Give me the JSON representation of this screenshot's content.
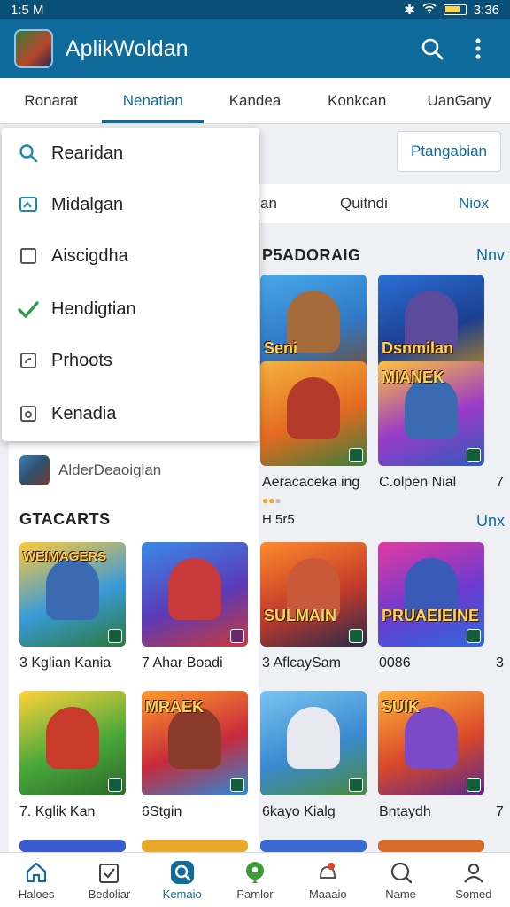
{
  "status": {
    "time": "1:5 M",
    "battery_text": "3:36"
  },
  "app": {
    "title": "AplikWoldan"
  },
  "tabs": [
    "Ronarat",
    "Nenatian",
    "Kandea",
    "Konkcan",
    "UanGany"
  ],
  "active_tab": 1,
  "filter_button": "Ptangabian",
  "chipbar": {
    "left": "an",
    "middle": "Quitndi",
    "right": "Niox"
  },
  "section1": {
    "title": "P5ADORAIG",
    "more": "Nnv"
  },
  "section2": {
    "more": "Unx"
  },
  "dropdown": [
    {
      "label": "Rearidan",
      "icon": "search-icon"
    },
    {
      "label": "Midalgan",
      "icon": "gallery-icon"
    },
    {
      "label": "Aiscigdha",
      "icon": "checkbox-empty-icon"
    },
    {
      "label": "Hendigtian",
      "icon": "check-icon"
    },
    {
      "label": "Prhoots",
      "icon": "photo-icon"
    },
    {
      "label": "Kenadia",
      "icon": "image-icon"
    }
  ],
  "left_panel": {
    "heading": "AlderDeaoiglan",
    "section": "GTACARTS"
  },
  "right_cards": [
    {
      "title": "Seni",
      "caption": ""
    },
    {
      "title": "Dsnmilan",
      "caption": ""
    },
    {
      "title": "",
      "caption": "Aeracaceka ing"
    },
    {
      "title": "MIANEK",
      "caption": "C.olpen Nial"
    },
    {
      "title": "SULMAIN",
      "caption": "3 AflcaySam"
    },
    {
      "title": "PRUAEIEINE",
      "caption": "0086"
    },
    {
      "title": "",
      "caption": "6kayo Kialg"
    },
    {
      "title": "SUIK",
      "caption": "Bntaydh"
    }
  ],
  "rating_text": "H 5r5",
  "left_cards": [
    {
      "title": "WEIMAGERS",
      "caption": "3 Kglian Kania"
    },
    {
      "title": "",
      "caption": "7 Ahar Boadi"
    },
    {
      "title": "",
      "caption": "7. Kglik Kan"
    },
    {
      "title": "MRAEK",
      "caption": "6Stgin"
    }
  ],
  "bottom_nav": [
    {
      "label": "Haloes",
      "icon": "home-icon"
    },
    {
      "label": "Bedoliar",
      "icon": "checklist-icon"
    },
    {
      "label": "Kemaio",
      "icon": "search-badge-icon"
    },
    {
      "label": "Pamlor",
      "icon": "location-icon"
    },
    {
      "label": "Maaaio",
      "icon": "notification-icon"
    },
    {
      "label": "Name",
      "icon": "chat-icon"
    },
    {
      "label": "Somed",
      "icon": "profile-icon"
    }
  ],
  "active_bottom": 2,
  "colors": {
    "primary": "#0f6b9c",
    "statusbar": "#0a4f78",
    "check": "#2e9e4a"
  }
}
